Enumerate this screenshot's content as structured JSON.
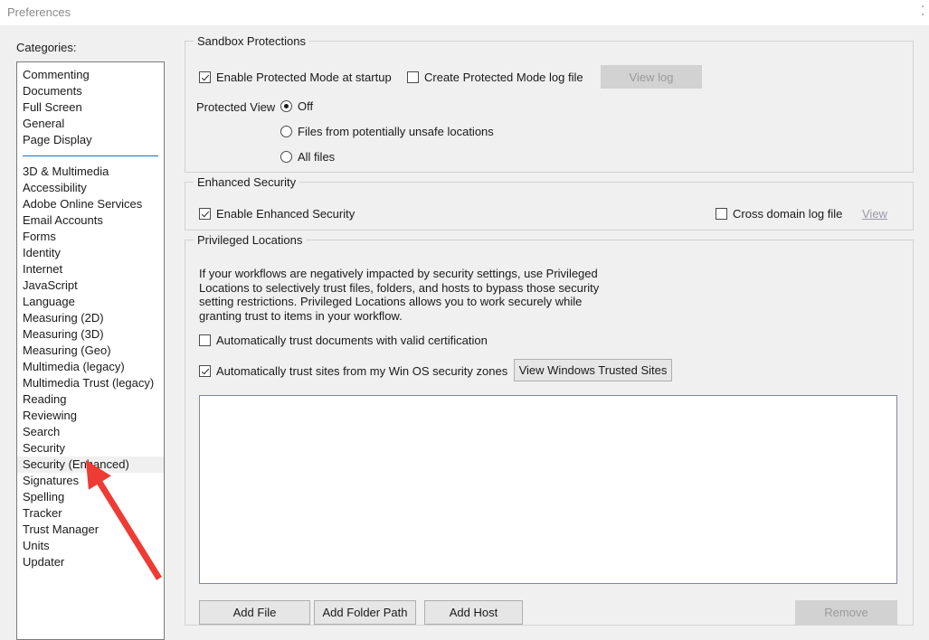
{
  "window": {
    "title": "Preferences"
  },
  "categories": {
    "label": "Categories:",
    "group_one": [
      "Commenting",
      "Documents",
      "Full Screen",
      "General",
      "Page Display"
    ],
    "group_two": [
      "3D & Multimedia",
      "Accessibility",
      "Adobe Online Services",
      "Email Accounts",
      "Forms",
      "Identity",
      "Internet",
      "JavaScript",
      "Language",
      "Measuring (2D)",
      "Measuring (3D)",
      "Measuring (Geo)",
      "Multimedia (legacy)",
      "Multimedia Trust (legacy)",
      "Reading",
      "Reviewing",
      "Search",
      "Security",
      "Security (Enhanced)",
      "Signatures",
      "Spelling",
      "Tracker",
      "Trust Manager",
      "Units",
      "Updater"
    ],
    "selected": "Security (Enhanced)"
  },
  "sandbox": {
    "title": "Sandbox Protections",
    "enable_protected_mode": {
      "label": "Enable Protected Mode at startup",
      "checked": true
    },
    "create_log_file": {
      "label": "Create Protected Mode log file",
      "checked": false
    },
    "view_log_button": {
      "label": "View log",
      "disabled": true
    },
    "protected_view_label": "Protected View",
    "protected_view_options": [
      {
        "label": "Off",
        "selected": true
      },
      {
        "label": "Files from potentially unsafe locations",
        "selected": false
      },
      {
        "label": "All files",
        "selected": false
      }
    ]
  },
  "enhanced_security": {
    "title": "Enhanced Security",
    "enable": {
      "label": "Enable Enhanced Security",
      "checked": true
    },
    "cross_domain_log": {
      "label": "Cross domain log file",
      "checked": false
    },
    "view_link": {
      "label": "View",
      "disabled": true
    }
  },
  "privileged_locations": {
    "title": "Privileged Locations",
    "description": "If your workflows are negatively impacted by security settings, use Privileged Locations to selectively trust files, folders, and hosts to bypass those security setting restrictions. Privileged Locations allows you to work securely while granting trust to items in your workflow.",
    "auto_trust_docs": {
      "label": "Automatically trust documents with valid certification",
      "checked": false
    },
    "auto_trust_sites": {
      "label": "Automatically trust sites from my Win OS security zones",
      "checked": true
    },
    "view_trusted_sites_button": {
      "label": "View Windows Trusted Sites"
    },
    "list_items": [],
    "buttons": {
      "add_file": "Add File",
      "add_folder_path": "Add Folder Path",
      "add_host": "Add Host",
      "remove": "Remove",
      "remove_disabled": true
    }
  },
  "annotation": {
    "arrow_color": "#ee3b33",
    "points_to": "Security (Enhanced)"
  }
}
